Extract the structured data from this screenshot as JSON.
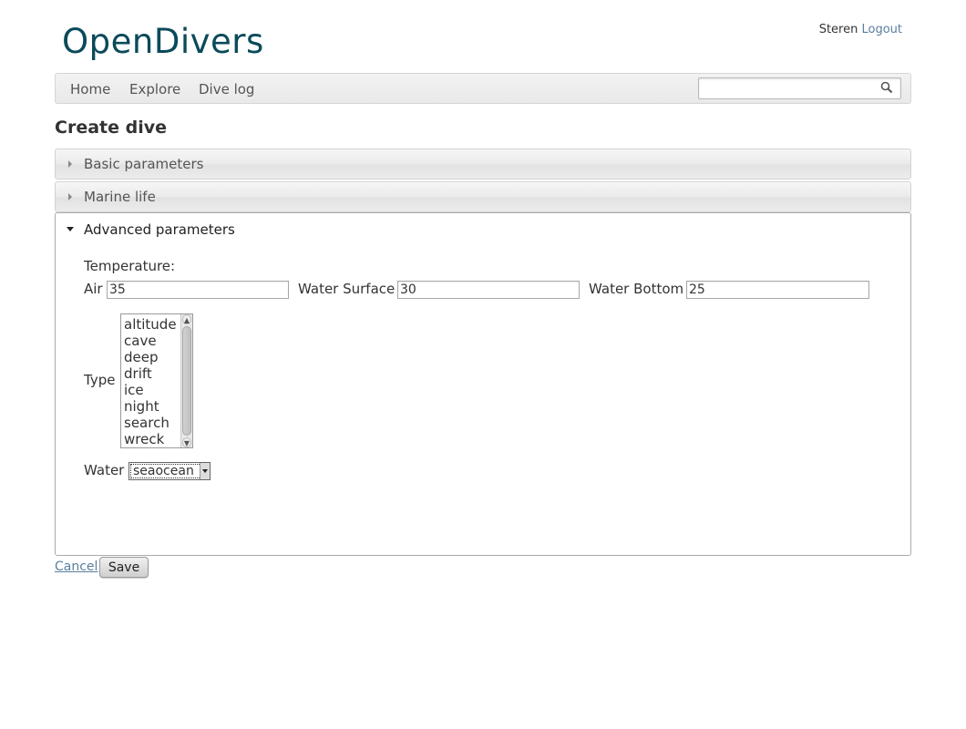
{
  "app": {
    "logo": "OpenDivers"
  },
  "user": {
    "name": "Steren",
    "logout_label": "Logout"
  },
  "nav": {
    "items": [
      {
        "label": "Home"
      },
      {
        "label": "Explore"
      },
      {
        "label": "Dive log"
      }
    ],
    "search": {
      "value": "",
      "icon": "search-icon"
    }
  },
  "page": {
    "title": "Create dive"
  },
  "accordion": {
    "sections": [
      {
        "label": "Basic parameters",
        "expanded": false
      },
      {
        "label": "Marine life",
        "expanded": false
      },
      {
        "label": "Advanced parameters",
        "expanded": true
      }
    ]
  },
  "advanced": {
    "temperature_label": "Temperature:",
    "air": {
      "label": "Air",
      "value": "35"
    },
    "water_surface": {
      "label": "Water Surface",
      "value": "30"
    },
    "water_bottom": {
      "label": "Water Bottom",
      "value": "25"
    },
    "type": {
      "label": "Type",
      "options": [
        "altitude",
        "cave",
        "deep",
        "drift",
        "ice",
        "night",
        "search",
        "wreck"
      ]
    },
    "water": {
      "label": "Water",
      "selected": "seaocean"
    }
  },
  "actions": {
    "cancel_label": "Cancel",
    "save_label": "Save"
  }
}
